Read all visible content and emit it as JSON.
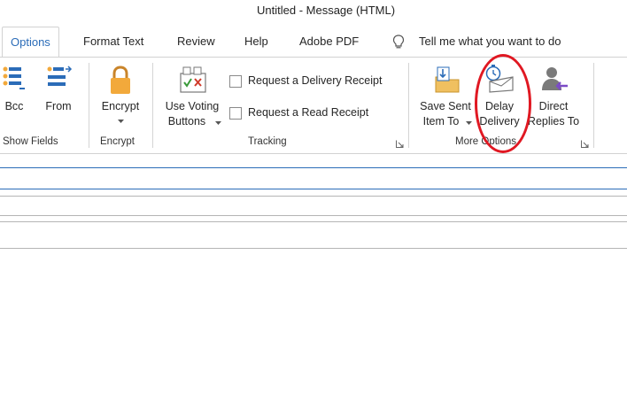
{
  "window": {
    "title": "Untitled  -  Message (HTML)"
  },
  "tabs": [
    {
      "label": "Options",
      "active": true
    },
    {
      "label": "Format Text"
    },
    {
      "label": "Review"
    },
    {
      "label": "Help"
    },
    {
      "label": "Adobe PDF"
    }
  ],
  "tell_me": {
    "label": "Tell me what you want to do",
    "icon": "lightbulb-icon"
  },
  "ribbon": {
    "show_fields": {
      "label": "Show Fields",
      "bcc": "Bcc",
      "from": "From"
    },
    "encrypt": {
      "label": "Encrypt",
      "button": "Encrypt"
    },
    "tracking": {
      "label": "Tracking",
      "voting_line1": "Use Voting",
      "voting_line2": "Buttons",
      "delivery_receipt": "Request a Delivery Receipt",
      "read_receipt": "Request a Read Receipt"
    },
    "more_options": {
      "label": "More Options",
      "save_sent_line1": "Save Sent",
      "save_sent_line2": "Item To",
      "delay_line1": "Delay",
      "delay_line2": "Delivery",
      "direct_line1": "Direct",
      "direct_line2": "Replies To"
    }
  },
  "colors": {
    "accent": "#2b6cb8",
    "annotation_circle": "#e01822",
    "lock": "#f2a93b",
    "person_gray": "#7a7a7a",
    "arrow_purple": "#7b4bc7"
  }
}
